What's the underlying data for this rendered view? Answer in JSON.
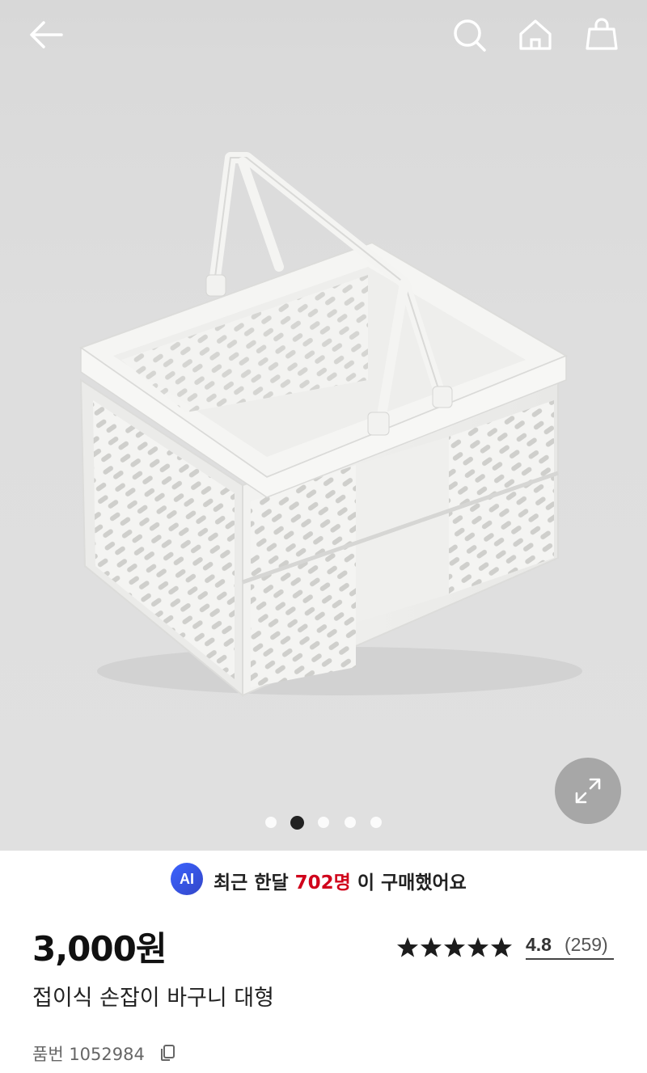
{
  "header": {
    "back_icon": "back-arrow-icon",
    "search_icon": "search-icon",
    "home_icon": "home-icon",
    "bag_icon": "shopping-bag-icon"
  },
  "gallery": {
    "image_subject": "folding plastic basket with handles",
    "expand_icon": "expand-arrows-icon",
    "page_count": 5,
    "active_index": 1
  },
  "ai_banner": {
    "badge": "AI",
    "text_before": "최근 한달 ",
    "highlight": "702명",
    "text_after": " 이 구매했어요",
    "highlight_color": "#d0021b"
  },
  "product": {
    "price": "3,000원",
    "rating_value": "4.8",
    "review_count": "(259)",
    "stars": 4.8,
    "name": "접이식 손잡이 바구니 대형",
    "sku_label": "품번 1052984"
  }
}
